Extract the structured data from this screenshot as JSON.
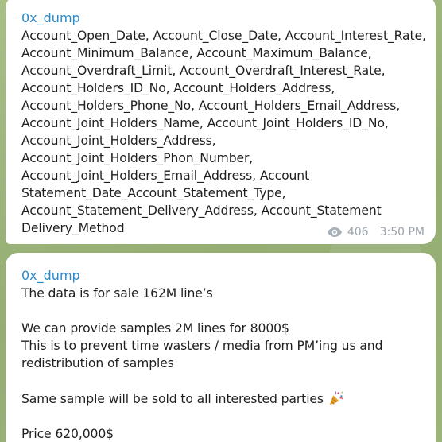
{
  "messages": [
    {
      "sender": "0x_dump",
      "text": "Account_Open_Date, Account_Close_Date, Account_Interest_Rate,\nAccount_Minimum_Balance, Account_Maximum_Balance,\nAccount_Overdraft_Limit, Account_Overdraft_Interest_Rate,\nAccount_Holders_ID_No, Account_Holders_Address,\nAccount_Holders_Phone_No, Account_Holders_Email_Address,\nAccount_Joint_Holders_Name, Account_Joint_Holders_ID_No,\nAccount_Joint_Holders_Address,\nAccount_Joint_Holders_Phon_Number,\nAccount_Joint_Holders_Email_Address, Account\nStatement_Date_Account_Statement_Type,\nAccount_Statement_Delivery_Address, Account_Statement\nDelivery_Method",
      "views": "406",
      "time": "3:50 PM"
    },
    {
      "sender": "0x_dump",
      "line1": "The data is for sale 162M line’s",
      "line2": "We can provide samples 2M lines for 8000$\nThis is to prevent time wasters / media from PM’ing  us and\nredistribution of samples",
      "line3": "Same sample will be sold to all interested parties",
      "line3_icon": "party-popper-icon",
      "line4": "Price 620,000$"
    }
  ],
  "colors": {
    "sender": "#2a8ac9",
    "meta": "#9aa3ab",
    "background": "#9fb77f"
  }
}
